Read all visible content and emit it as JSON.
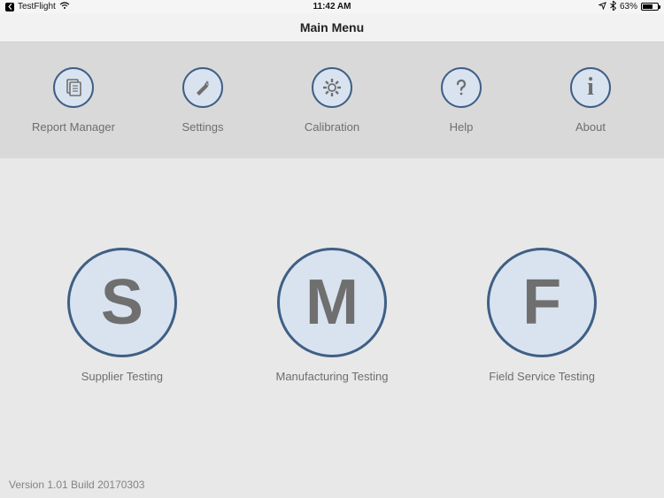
{
  "status_bar": {
    "back_app": "TestFlight",
    "time": "11:42 AM",
    "battery_pct": "63%"
  },
  "header": {
    "title": "Main Menu"
  },
  "top_menu": [
    {
      "icon": "documents-icon",
      "label": "Report Manager"
    },
    {
      "icon": "wrench-icon",
      "label": "Settings"
    },
    {
      "icon": "gear-icon",
      "label": "Calibration"
    },
    {
      "icon": "question-icon",
      "label": "Help"
    },
    {
      "icon": "info-icon",
      "label": "About"
    }
  ],
  "main_menu": [
    {
      "letter": "S",
      "label": "Supplier Testing"
    },
    {
      "letter": "M",
      "label": "Manufacturing Testing"
    },
    {
      "letter": "F",
      "label": "Field Service Testing"
    }
  ],
  "footer": {
    "version": "Version 1.01 Build 20170303"
  }
}
